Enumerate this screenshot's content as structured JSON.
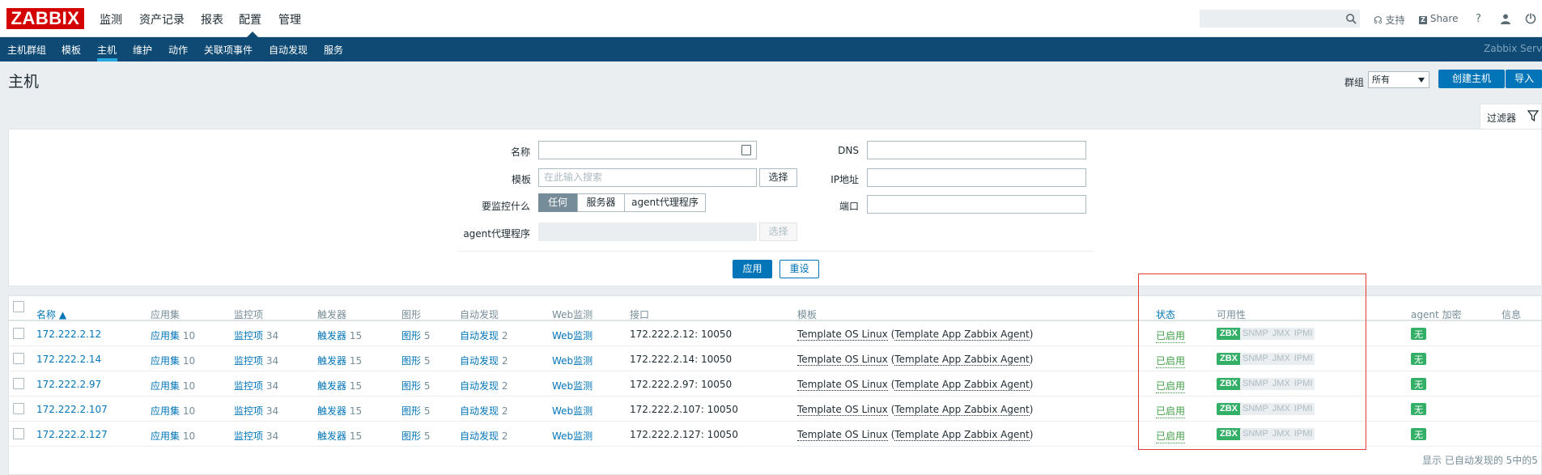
{
  "header": {
    "logo": "ZABBIX",
    "menu": [
      "监测",
      "资产记录",
      "报表",
      "配置",
      "管理"
    ],
    "active_menu": "配置",
    "support": "支持",
    "share": "Share",
    "help": "?"
  },
  "subnav": {
    "items": [
      "主机群组",
      "模板",
      "主机",
      "维护",
      "动作",
      "关联项事件",
      "自动发现",
      "服务"
    ],
    "active": "主机",
    "server": "Zabbix Server"
  },
  "page": {
    "title": "主机",
    "group_label": "群组",
    "group_value": "所有",
    "create_button": "创建主机",
    "import_button": "导入"
  },
  "filter": {
    "tab_label": "过滤器",
    "name_label": "名称",
    "template_label": "模板",
    "template_placeholder": "在此输入搜索",
    "select_button": "选择",
    "monitor_label": "要监控什么",
    "monitor_options": [
      "任何",
      "服务器",
      "agent代理程序"
    ],
    "proxy_label": "agent代理程序",
    "proxy_select": "选择",
    "dns_label": "DNS",
    "ip_label": "IP地址",
    "port_label": "端口",
    "apply": "应用",
    "reset": "重设"
  },
  "table": {
    "columns": [
      "名称 ▲",
      "应用集",
      "监控项",
      "触发器",
      "图形",
      "自动发现",
      "Web监测",
      "接口",
      "模板",
      "状态",
      "可用性",
      "agent 加密",
      "信息"
    ],
    "rows": [
      {
        "name": "172.222.2.12",
        "apps": "应用集",
        "apps_n": "10",
        "items": "监控项",
        "items_n": "34",
        "triggers": "触发器",
        "triggers_n": "15",
        "graphs": "图形",
        "graphs_n": "5",
        "discovery": "自动发现",
        "discovery_n": "2",
        "web": "Web监测",
        "iface": "172.222.2.12: 10050",
        "tpl": "Template OS Linux",
        "tpl_sub": "Template App Zabbix Agent",
        "status": "已启用"
      },
      {
        "name": "172.222.2.14",
        "apps": "应用集",
        "apps_n": "10",
        "items": "监控项",
        "items_n": "34",
        "triggers": "触发器",
        "triggers_n": "15",
        "graphs": "图形",
        "graphs_n": "5",
        "discovery": "自动发现",
        "discovery_n": "2",
        "web": "Web监测",
        "iface": "172.222.2.14: 10050",
        "tpl": "Template OS Linux",
        "tpl_sub": "Template App Zabbix Agent",
        "status": "已启用"
      },
      {
        "name": "172.222.2.97",
        "apps": "应用集",
        "apps_n": "10",
        "items": "监控项",
        "items_n": "34",
        "triggers": "触发器",
        "triggers_n": "15",
        "graphs": "图形",
        "graphs_n": "5",
        "discovery": "自动发现",
        "discovery_n": "2",
        "web": "Web监测",
        "iface": "172.222.2.97: 10050",
        "tpl": "Template OS Linux",
        "tpl_sub": "Template App Zabbix Agent",
        "status": "已启用"
      },
      {
        "name": "172.222.2.107",
        "apps": "应用集",
        "apps_n": "10",
        "items": "监控项",
        "items_n": "34",
        "triggers": "触发器",
        "triggers_n": "15",
        "graphs": "图形",
        "graphs_n": "5",
        "discovery": "自动发现",
        "discovery_n": "2",
        "web": "Web监测",
        "iface": "172.222.2.107: 10050",
        "tpl": "Template OS Linux",
        "tpl_sub": "Template App Zabbix Agent",
        "status": "已启用"
      },
      {
        "name": "172.222.2.127",
        "apps": "应用集",
        "apps_n": "10",
        "items": "监控项",
        "items_n": "34",
        "triggers": "触发器",
        "triggers_n": "15",
        "graphs": "图形",
        "graphs_n": "5",
        "discovery": "自动发现",
        "discovery_n": "2",
        "web": "Web监测",
        "iface": "172.222.2.127: 10050",
        "tpl": "Template OS Linux",
        "tpl_sub": "Template App Zabbix Agent",
        "status": "已启用"
      }
    ],
    "availability": [
      "ZBX",
      "SNMP",
      "JMX",
      "IPMI"
    ],
    "encryption": "无",
    "footer": "显示 已自动发现的 5中的5"
  },
  "colors": {
    "brand": "#d40000",
    "nav": "#0e4a73",
    "link": "#0275b8",
    "enabled": "#429e47",
    "available": "#34af67",
    "highlight": "#e53935"
  }
}
